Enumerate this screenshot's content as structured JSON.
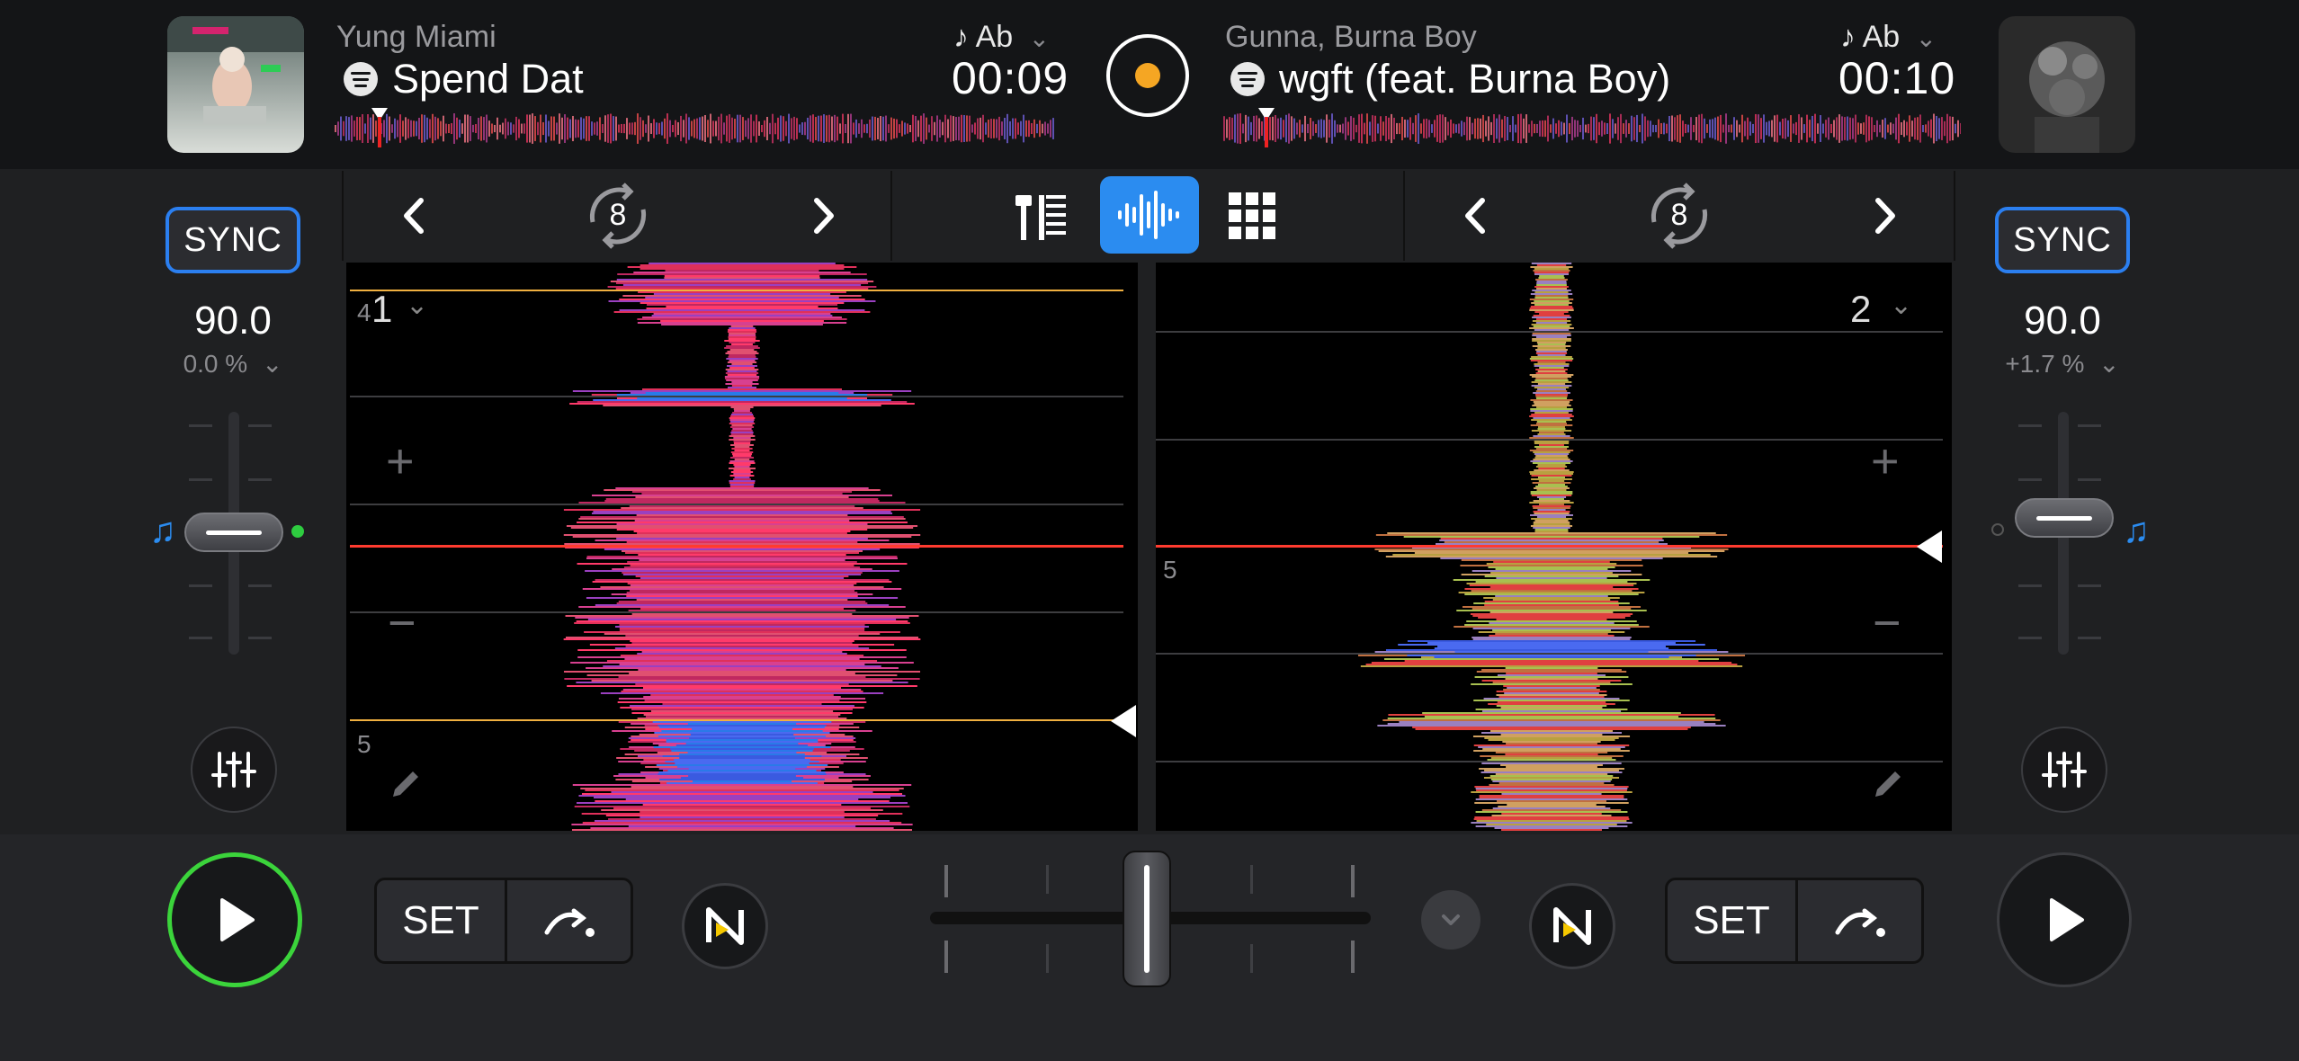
{
  "deck_a": {
    "artist": "Yung Miami",
    "title": "Spend Dat",
    "key": "Ab",
    "time": "00:09",
    "sync_label": "SYNC",
    "bpm": "90.0",
    "pitch": "0.0 %",
    "deck_number": "1",
    "beat_counter_small": "4",
    "bar_marker": "5",
    "set_label": "SET",
    "loop_size": "8"
  },
  "deck_b": {
    "artist": "Gunna, Burna Boy",
    "title": "wgft (feat. Burna Boy)",
    "key": "Ab",
    "time": "00:10",
    "sync_label": "SYNC",
    "bpm": "90.0",
    "pitch": "+1.7 %",
    "deck_number": "2",
    "bar_marker": "5",
    "set_label": "SET",
    "loop_size": "8"
  },
  "glyphs": {
    "plus": "+",
    "minus": "−",
    "prev": "‹",
    "next": "›",
    "chevron": "⌄",
    "note": "♪",
    "music_note": "♫"
  },
  "colors": {
    "accent_blue": "#2b8cf0",
    "play_ring_active": "#3bd43b",
    "record_dot": "#f5a623",
    "cue_line": "#f0b040",
    "playhead_red": "#ff3b2f"
  },
  "crossfader_position": 0.5,
  "channel_fader_a_level": 0.5,
  "channel_fader_b_level": 0.55
}
